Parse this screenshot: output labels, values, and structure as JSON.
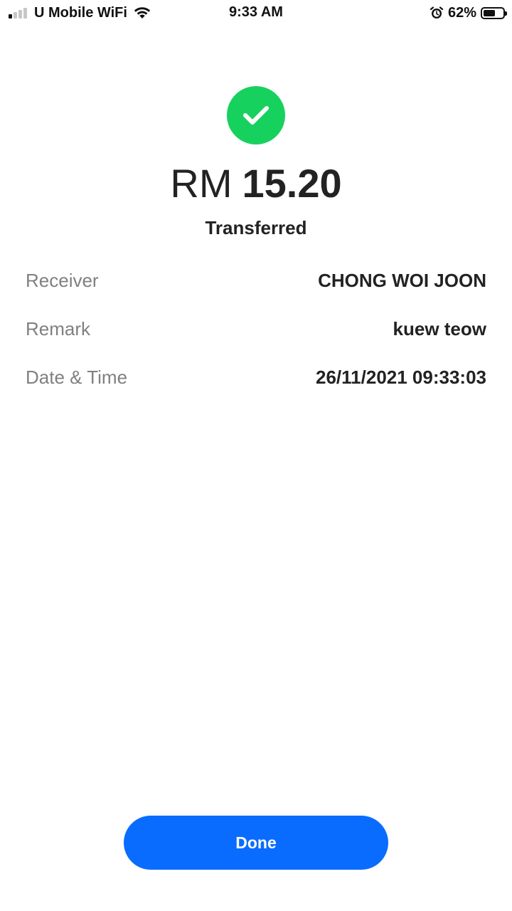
{
  "status_bar": {
    "carrier": "U Mobile WiFi",
    "time": "9:33 AM",
    "battery_percent": "62%",
    "battery_level": 0.62,
    "signal_bars_active": 1,
    "signal_bars_total": 4,
    "icons": [
      "signal-icon",
      "wifi-icon",
      "alarm-icon",
      "battery-icon"
    ]
  },
  "result": {
    "icon": "check-icon",
    "icon_color": "#17d15e",
    "currency": "RM",
    "amount": "15.20",
    "status": "Transferred"
  },
  "details": [
    {
      "label": "Receiver",
      "value": "CHONG WOI JOON"
    },
    {
      "label": "Remark",
      "value": "kuew teow"
    },
    {
      "label": "Date & Time",
      "value": "26/11/2021 09:33:03"
    }
  ],
  "actions": {
    "done_label": "Done",
    "done_color": "#0a6cff"
  }
}
